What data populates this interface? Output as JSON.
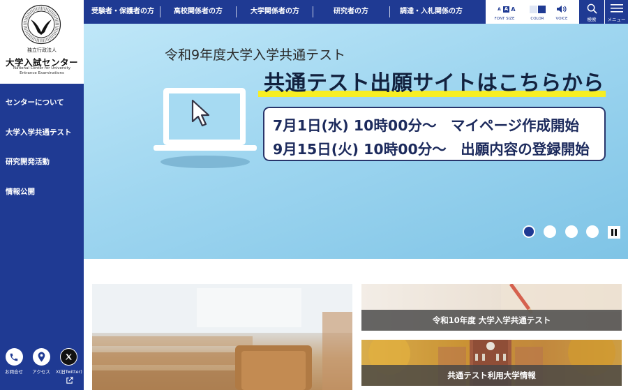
{
  "logo": {
    "org_type": "独立行政法人",
    "name": "大学入試センター",
    "name_en_line1": "National Center for University",
    "name_en_line2": "Entrance Examinations",
    "seal_text": "NATIONAL CENTER FOR UNIVERSITY ENTRANCE EXAMINATIONS"
  },
  "sidebar": {
    "items": [
      {
        "label": "センターについて"
      },
      {
        "label": "大学入学共通テスト"
      },
      {
        "label": "研究開発活動"
      },
      {
        "label": "情報公開"
      }
    ],
    "footer": {
      "contact_label": "お問合せ",
      "access_label": "アクセス",
      "x_label": "X(旧Twitter)"
    }
  },
  "topnav": {
    "items": [
      {
        "label": "受験者・保護者の方"
      },
      {
        "label": "高校関係者の方"
      },
      {
        "label": "大学関係者の方"
      },
      {
        "label": "研究者の方"
      },
      {
        "label": "調達・入札関係の方"
      }
    ]
  },
  "utility": {
    "font_size_label": "FONT SIZE",
    "font_size_options": [
      "A",
      "A",
      "A"
    ],
    "color_label": "COLOR",
    "voice_label": "VOICE",
    "search_label": "検索",
    "menu_label": "メニュー"
  },
  "hero": {
    "subtitle": "令和9年度大学入学共通テスト",
    "title": "共通テスト出願サイトはこちらから",
    "line1": "7月1日(水) 10時00分〜　マイページ作成開始",
    "line2": "9月15日(火) 10時00分〜　出願内容の登録開始",
    "slide_count": 4,
    "active_slide": 1,
    "accent_color": "#f7ee23"
  },
  "cards": {
    "right_top_label": "令和10年度 大学入学共通テスト",
    "right_bottom_label": "共通テスト利用大学情報"
  },
  "colors": {
    "brand_navy": "#1f3a93",
    "hero_sky": "#9fd6f0"
  }
}
